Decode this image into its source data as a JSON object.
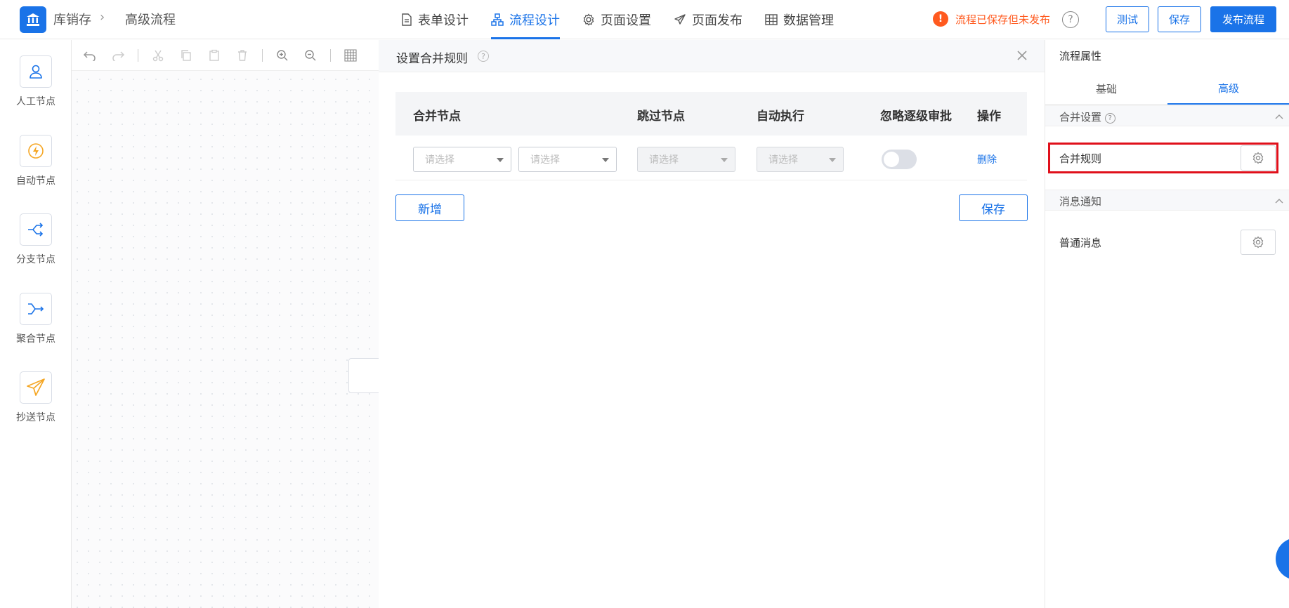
{
  "header": {
    "breadcrumb": [
      "库销存",
      "高级流程"
    ],
    "tabs": [
      {
        "label": "表单设计",
        "icon": "document-icon",
        "active": false
      },
      {
        "label": "流程设计",
        "icon": "flowchart-icon",
        "active": true
      },
      {
        "label": "页面设置",
        "icon": "gear-icon",
        "active": false
      },
      {
        "label": "页面发布",
        "icon": "send-icon",
        "active": false
      },
      {
        "label": "数据管理",
        "icon": "table-icon",
        "active": false
      }
    ],
    "status_text": "流程已保存但未发布",
    "buttons": {
      "test": "测试",
      "save": "保存",
      "publish": "发布流程"
    },
    "accent_color": "#1a73e8",
    "warning_color": "#ff5a1f"
  },
  "palette": {
    "nodes": [
      {
        "label": "人工节点",
        "icon": "user-icon"
      },
      {
        "label": "自动节点",
        "icon": "lightning-icon"
      },
      {
        "label": "分支节点",
        "icon": "branch-icon"
      },
      {
        "label": "聚合节点",
        "icon": "merge-icon"
      },
      {
        "label": "抄送节点",
        "icon": "paper-plane-icon"
      }
    ]
  },
  "dialog": {
    "title": "设置合并规则",
    "columns": [
      "合并节点",
      "跳过节点",
      "自动执行",
      "忽略逐级审批",
      "操作"
    ],
    "row": {
      "merge_placeholder_1": "请选择",
      "merge_placeholder_2": "请选择",
      "skip_placeholder": "请选择",
      "auto_placeholder": "请选择",
      "ignore_toggle": false,
      "delete_label": "删除"
    },
    "add_button": "新增",
    "save_button": "保存"
  },
  "properties": {
    "title": "流程属性",
    "tabs": [
      {
        "label": "基础",
        "active": false
      },
      {
        "label": "高级",
        "active": true
      }
    ],
    "merge_section": "合并设置",
    "merge_rule_label": "合并规则",
    "notify_section": "消息通知",
    "normal_message_label": "普通消息"
  }
}
